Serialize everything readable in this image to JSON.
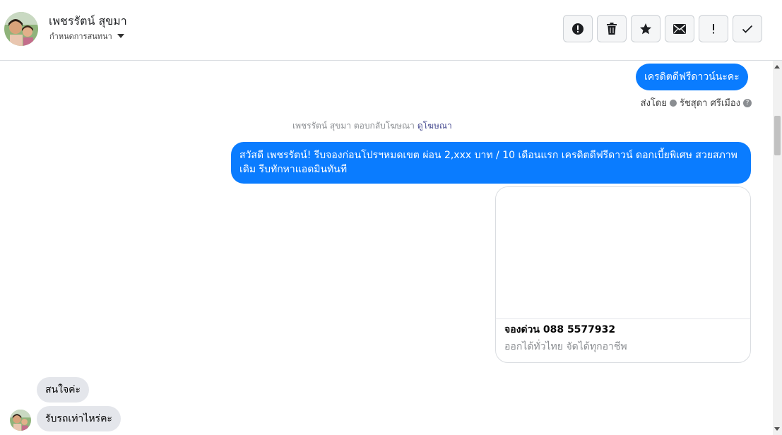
{
  "header": {
    "contact_name": "เพชรรัตน์ สุขมา",
    "assign_label": "กำหนดการสนทนา",
    "toolbar": [
      {
        "name": "report-spam-button",
        "icon": "exclamation-circle-icon"
      },
      {
        "name": "delete-button",
        "icon": "trash-icon"
      },
      {
        "name": "star-button",
        "icon": "star-icon"
      },
      {
        "name": "mark-unread-button",
        "icon": "envelope-icon"
      },
      {
        "name": "follow-up-button",
        "icon": "exclamation-icon"
      },
      {
        "name": "mark-done-button",
        "icon": "check-icon"
      }
    ]
  },
  "thread": {
    "outgoing_1": "เครดิตดีฟรีดาวน์นะคะ",
    "sent_by_prefix": "ส่งโดย",
    "sent_by_name": "รัชสุดา ศรีเมือง",
    "help_glyph": "?",
    "ad_reply_text": "เพชรรัตน์ สุขมา ตอบกลับโฆษณา",
    "ad_reply_link": "ดูโฆษณา",
    "outgoing_2": "สวัสดี เพชรรัตน์! รีบจองก่อนโปรฯหมดเขต ผ่อน 2,xxx บาท / 10 เดือนแรก เครดิตดีฟรีดาวน์ ดอกเบี้ยพิเศษ สวยสภาพเดิม รีบทักหาแอดมินทันที",
    "ad_card": {
      "title": "จองด่วน 088 5577932",
      "subtitle": "ออกได้ทั่วไทย จัดได้ทุกอาชีพ"
    },
    "incoming_1": "สนใจค่ะ",
    "incoming_2": "รับรถเท่าไหร่คะ"
  },
  "colors": {
    "outgoing_bubble": "#0a7cff",
    "incoming_bubble": "#e4e6eb",
    "link": "#4b4f93"
  }
}
